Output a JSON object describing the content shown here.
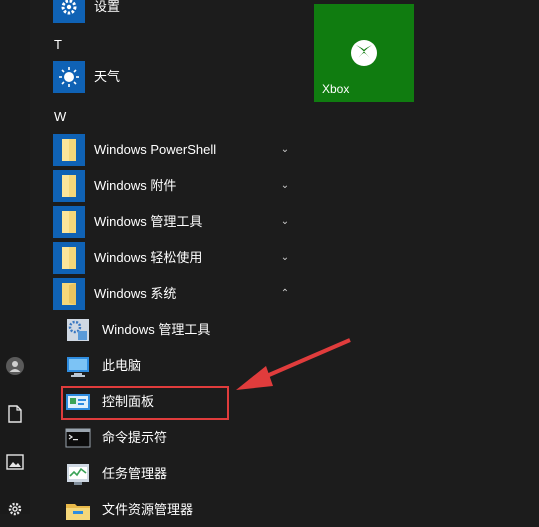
{
  "left_rail": {
    "icons": [
      "user-icon",
      "document-icon",
      "pictures-icon",
      "settings-icon"
    ]
  },
  "app_list": {
    "top_item": {
      "label": "设置",
      "icon": "gear-icon"
    },
    "section_t": "T",
    "weather": {
      "label": "天气",
      "icon": "sun-icon"
    },
    "section_w": "W",
    "folders": [
      {
        "label": "Windows PowerShell",
        "chevron": "⌄"
      },
      {
        "label": "Windows 附件",
        "chevron": "⌄"
      },
      {
        "label": "Windows 管理工具",
        "chevron": "⌄"
      },
      {
        "label": "Windows 轻松使用",
        "chevron": "⌄"
      },
      {
        "label": "Windows 系统",
        "chevron": "⌃"
      }
    ],
    "system_items": [
      {
        "label": "Windows 管理工具",
        "icon": "admin-tools-icon"
      },
      {
        "label": "此电脑",
        "icon": "this-pc-icon"
      },
      {
        "label": "控制面板",
        "icon": "control-panel-icon"
      },
      {
        "label": "命令提示符",
        "icon": "command-prompt-icon"
      },
      {
        "label": "任务管理器",
        "icon": "task-manager-icon"
      },
      {
        "label": "文件资源管理器",
        "icon": "file-explorer-icon"
      }
    ]
  },
  "tiles": {
    "xbox": {
      "label": "Xbox",
      "color": "#107c10"
    }
  },
  "colors": {
    "accent": "#0f62b5",
    "highlight": "#e03c3c",
    "background": "#1c1c1c"
  }
}
